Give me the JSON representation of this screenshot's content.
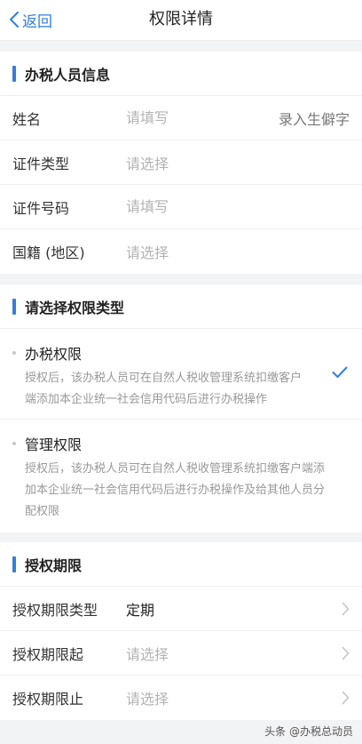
{
  "nav": {
    "back_label": "返回",
    "title": "权限详情"
  },
  "taxperson": {
    "section_title": "办税人员信息",
    "name_label": "姓名",
    "name_placeholder": "请填写",
    "name_extra": "录入生僻字",
    "id_type_label": "证件类型",
    "id_type_placeholder": "请选择",
    "id_number_label": "证件号码",
    "id_number_placeholder": "请填写",
    "nationality_label": "国籍 (地区)",
    "nationality_placeholder": "请选择"
  },
  "permission": {
    "section_title": "请选择权限类型",
    "options": [
      {
        "title": "办税权限",
        "desc": "授权后，该办税人员可在自然人税收管理系统扣缴客户端添加本企业统一社会信用代码后进行办税操作",
        "selected": true
      },
      {
        "title": "管理权限",
        "desc": "授权后，该办税人员可在自然人税收管理系统扣缴客户端添加本企业统一社会信用代码后进行办税操作及给其他人员分配权限",
        "selected": false
      }
    ]
  },
  "period": {
    "section_title": "授权期限",
    "type_label": "授权期限类型",
    "type_value": "定期",
    "start_label": "授权期限起",
    "start_placeholder": "请选择",
    "end_label": "授权期限止",
    "end_placeholder": "请选择"
  },
  "footer": {
    "watermark": "头条 @办税总动员"
  },
  "colors": {
    "accent": "#2f7ee6",
    "placeholder": "#b3b3b3",
    "background": "#f2f3f5"
  }
}
